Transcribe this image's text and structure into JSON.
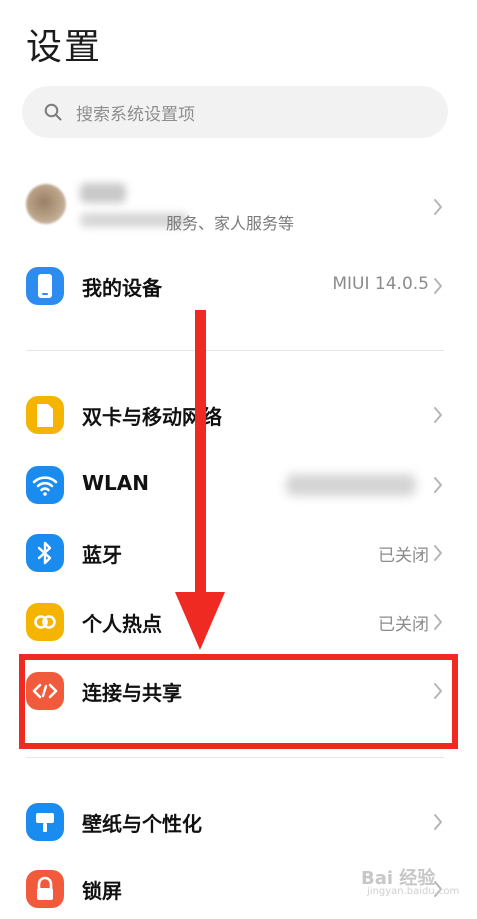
{
  "page": {
    "title": "设置"
  },
  "search": {
    "placeholder": "搜索系统设置项"
  },
  "account": {
    "subtitle": "服务、家人服务等"
  },
  "items": [
    {
      "label": "我的设备",
      "value": "MIUI 14.0.5",
      "icon": "phone-icon",
      "color": "#2d8cf0"
    },
    {
      "label": "双卡与移动网络",
      "value": "",
      "icon": "sim-card-icon",
      "color": "#f5b400"
    },
    {
      "label": "WLAN",
      "value": "",
      "icon": "wifi-icon",
      "color": "#1a8cf0"
    },
    {
      "label": "蓝牙",
      "value": "已关闭",
      "icon": "bluetooth-icon",
      "color": "#1a8cf0"
    },
    {
      "label": "个人热点",
      "value": "已关闭",
      "icon": "hotspot-icon",
      "color": "#f5b400"
    },
    {
      "label": "连接与共享",
      "value": "",
      "icon": "connection-sharing-icon",
      "color": "#f15a3a"
    },
    {
      "label": "壁纸与个性化",
      "value": "",
      "icon": "wallpaper-icon",
      "color": "#1a8cf0"
    },
    {
      "label": "锁屏",
      "value": "",
      "icon": "lock-icon",
      "color": "#f15a3a"
    }
  ],
  "annotation": {
    "highlight_color": "#ef2a22"
  },
  "watermark": {
    "text": "Bai 经验",
    "sub": "jingyan.baidu.com"
  }
}
